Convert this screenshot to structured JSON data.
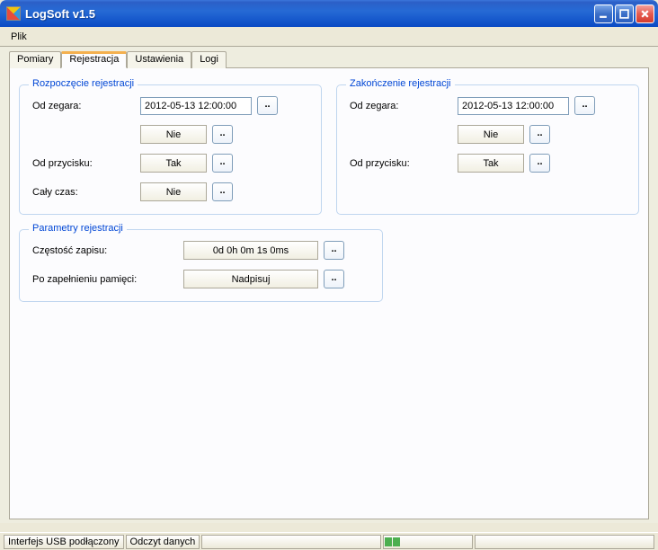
{
  "window": {
    "title": "LogSoft v1.5"
  },
  "menu": {
    "plik": "Plik"
  },
  "tabs": {
    "pomiary": "Pomiary",
    "rejestracja": "Rejestracja",
    "ustawienia": "Ustawienia",
    "logi": "Logi"
  },
  "groups": {
    "start": "Rozpoczęcie rejestracji",
    "end": "Zakończenie rejestracji",
    "params": "Parametry rejestracji"
  },
  "labels": {
    "od_zegara": "Od zegara:",
    "od_przycisku": "Od przycisku:",
    "caly_czas": "Cały czas:",
    "czestosc_zapisu": "Częstość zapisu:",
    "po_zapelnieniu": "Po zapełnieniu pamięci:"
  },
  "values": {
    "start_time": "2012-05-13 12:00:00",
    "start_zegar_enabled": "Nie",
    "start_przycisk": "Tak",
    "start_caly_czas": "Nie",
    "end_time": "2012-05-13 12:00:00",
    "end_zegar_enabled": "Nie",
    "end_przycisk": "Tak",
    "freq": "0d 0h 0m 1s 0ms",
    "overflow": "Nadpisuj"
  },
  "status": {
    "usb": "Interfejs USB podłączony",
    "action": "Odczyt danych"
  }
}
